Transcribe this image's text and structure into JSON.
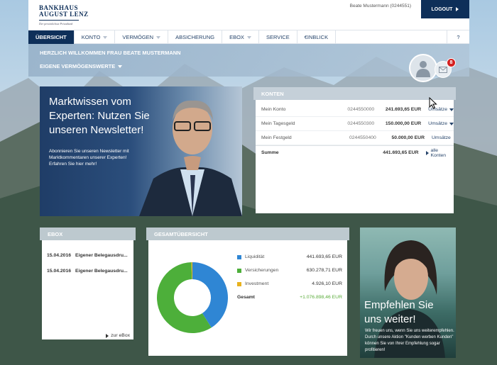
{
  "header": {
    "logo_line1": "BANKHAUS",
    "logo_line2": "AUGUST LENZ",
    "logo_tagline": "Der persönlichste Privatbank",
    "user": "Beate Mustermann (0244551)",
    "logout_label": "LOGOUT"
  },
  "nav": {
    "items": [
      {
        "label": "ÜBERSICHT",
        "active": true
      },
      {
        "label": "KONTO"
      },
      {
        "label": "VERMÖGEN"
      },
      {
        "label": "ABSICHERUNG"
      },
      {
        "label": "EBOX"
      },
      {
        "label": "SERVICE"
      },
      {
        "label": "€INBLICK"
      }
    ],
    "help": "?"
  },
  "welcome": {
    "title": "HERZLICH WILLKOMMEN FRAU BEATE MUSTERMANN",
    "subtitle": "EIGENE VERMÖGENSWERTE"
  },
  "notifications": {
    "count": "8"
  },
  "promo": {
    "title": "Marktwissen vom Experten: Nutzen Sie unseren Newsletter!",
    "text": "Abonnieren Sie unseren Newsletter mit Marktkommentaren unserer Experten! Erfahren Sie hier mehr!"
  },
  "konten": {
    "title": "KONTEN",
    "rows": [
      {
        "name": "Mein Konto",
        "nr": "0244550000",
        "amount": "241.693,65 EUR",
        "link": "Umsätze"
      },
      {
        "name": "Mein Tagesgeld",
        "nr": "0244550300",
        "amount": "150.000,00 EUR",
        "link": "Umsätze"
      },
      {
        "name": "Mein Festgeld",
        "nr": "0244550400",
        "amount": "50.000,00 EUR",
        "link": "Umsätze"
      }
    ],
    "sum_label": "Summe",
    "sum_amount": "441.693,65 EUR",
    "all_link": "alle Konten"
  },
  "ebox": {
    "title": "EBOX",
    "items": [
      {
        "date": "15.04.2016",
        "text": "Eigener Belegausdru..."
      },
      {
        "date": "15.04.2016",
        "text": "Eigener Belegausdru..."
      }
    ],
    "link": "zur eBox"
  },
  "overview": {
    "title": "GESAMTÜBERSICHT",
    "rows": [
      {
        "label": "Liquidität",
        "value": "441.693,65 EUR",
        "color": "#2f86d4"
      },
      {
        "label": "Versicherungen",
        "value": "630.278,71 EUR",
        "color": "#4daf3a"
      },
      {
        "label": "Investment",
        "value": "4.926,10 EUR",
        "color": "#e8b21e"
      }
    ],
    "total_label": "Gesamt",
    "total_value": "+1.076.898,46 EUR"
  },
  "recommend": {
    "title": "Empfehlen Sie uns weiter!",
    "text": "Wir freuen uns, wenn Sie uns weiterempfehlen. Durch unsere Aktion \"Kunden werben Kunden\" können Sie von Ihrer Empfehlung sogar profitieren!"
  },
  "chart_data": {
    "type": "pie",
    "categories": [
      "Liquidität",
      "Versicherungen",
      "Investment"
    ],
    "values": [
      441693.65,
      630278.71,
      4926.1
    ],
    "colors": [
      "#2f86d4",
      "#4daf3a",
      "#e8b21e"
    ]
  }
}
